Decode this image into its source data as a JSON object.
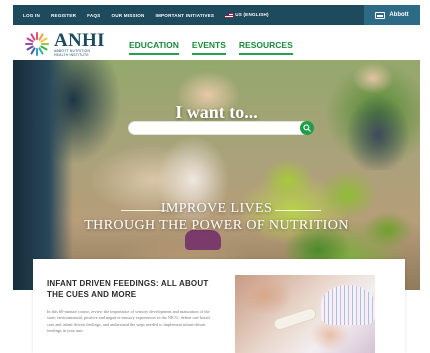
{
  "topbar": {
    "links": [
      "LOG IN",
      "REGISTER",
      "FAQS",
      "OUR MISSION",
      "IMPORTANT INITIATIVES"
    ],
    "language": "US (English)",
    "abbott_label": "Abbott"
  },
  "header": {
    "logo_main": "ANHI",
    "logo_sub_1": "ABBOTT NUTRITION",
    "logo_sub_2": "HEALTH INSTITUTE",
    "nav": [
      "EDUCATION",
      "EVENTS",
      "RESOURCES"
    ]
  },
  "hero": {
    "question": "I want to...",
    "search": {
      "value": "",
      "placeholder": ""
    },
    "tagline_line1": "IMPROVE LIVES",
    "tagline_line2": "THROUGH THE POWER OF NUTRITION"
  },
  "feature": {
    "title": "INFANT DRIVEN FEEDINGS: ALL ABOUT THE CUES AND MORE",
    "body": "In this 60-minute course, review the importance of sensory development and maturation of the state, environmental, positive and negative sensory experiences in the NICU; define cue-based care and infant-driven feedings, and understand the steps needed to implement infant-driven feedings in your unit."
  },
  "colors": {
    "topbar": "#1e4a5e",
    "abbott_button": "#2d6a86",
    "nav_green": "#1c8a3c",
    "search_button": "#1f9e4a"
  }
}
